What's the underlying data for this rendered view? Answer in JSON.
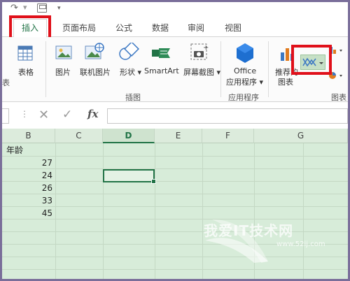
{
  "tabs": {
    "insert": "插入",
    "page_layout": "页面布局",
    "formulas": "公式",
    "data": "数据",
    "review": "审阅",
    "view": "视图"
  },
  "ribbon": {
    "table_partial": "表格",
    "table_group_partial": "表",
    "picture": "图片",
    "online_picture": "联机图片",
    "shapes": "形状",
    "smartart": "SmartArt",
    "screenshot": "屏幕截图",
    "illustrations_group": "插图",
    "office_apps_line1": "Office",
    "office_apps_line2": "应用程序",
    "apps_group": "应用程序",
    "recommended_line1": "推荐的",
    "recommended_line2": "图表",
    "charts_group": "图表"
  },
  "formula_bar": {
    "fx": "fx",
    "cancel": "✕",
    "enter": "✓",
    "value": ""
  },
  "columns": [
    "B",
    "C",
    "D",
    "E",
    "F",
    "G"
  ],
  "selected_column": "D",
  "sheet": {
    "header_cell": "年龄",
    "values": [
      "27",
      "24",
      "26",
      "33",
      "45"
    ]
  },
  "watermark": {
    "text": "我爱IT技术网",
    "url": "www.52ij.com"
  },
  "colors": {
    "accent": "#217346",
    "highlight": "#e0101a",
    "grid_bg": "#d7ecd9"
  }
}
